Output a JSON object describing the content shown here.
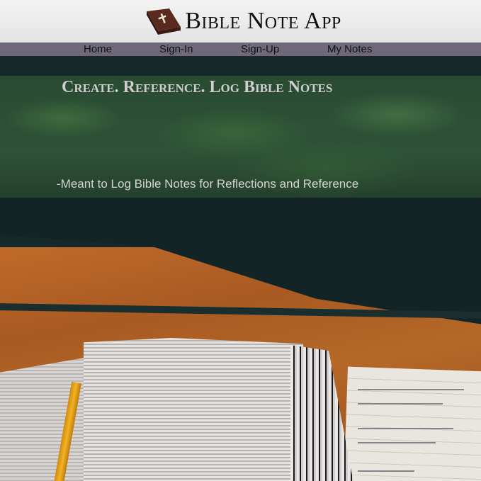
{
  "header": {
    "title": "Bible Note App",
    "logo_icon": "bible-book-icon"
  },
  "nav": {
    "items": [
      {
        "label": "Home"
      },
      {
        "label": "Sign-In"
      },
      {
        "label": "Sign-Up"
      },
      {
        "label": "My Notes"
      }
    ]
  },
  "hero": {
    "tagline": "Create. Reference. Log Bible Notes",
    "subtext": "-Meant to Log Bible Notes for Reflections and Reference"
  },
  "colors": {
    "nav_bar": "#6f6878",
    "book_brown": "#5a2a1e",
    "header_bg": "#ececec"
  }
}
